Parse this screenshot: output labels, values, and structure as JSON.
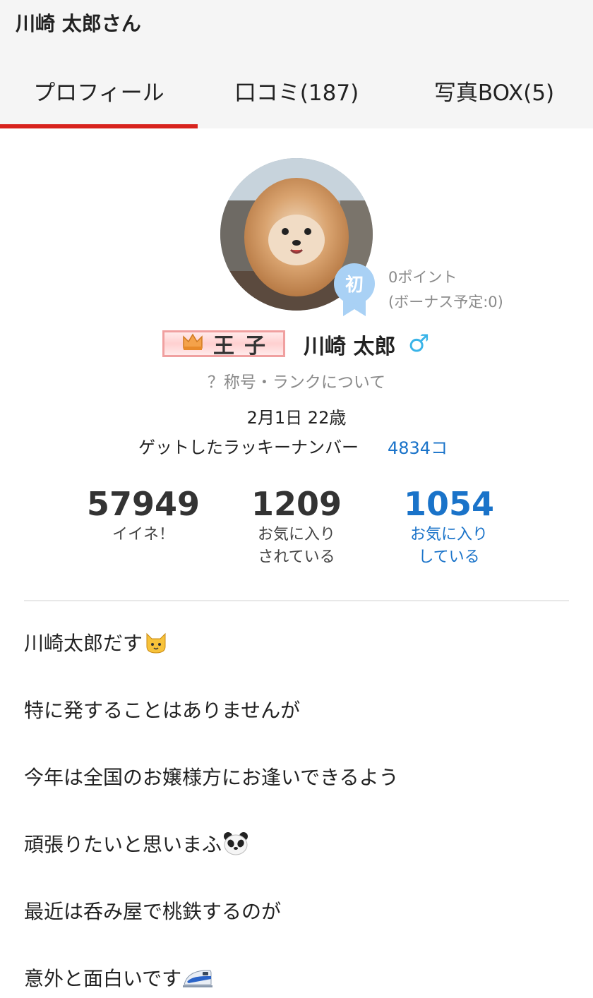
{
  "header": {
    "title": "川崎 太郎さん",
    "tabs": [
      {
        "label": "プロフィール",
        "active": true
      },
      {
        "label": "口コミ(187)",
        "active": false
      },
      {
        "label": "写真BOX(5)",
        "active": false
      }
    ],
    "accent_color": "#d8231d"
  },
  "profile": {
    "badge_char": "初",
    "points": "0ポイント",
    "bonus": "(ボーナス予定:0)",
    "rank_title_char1": "王",
    "rank_title_char2": "子",
    "name": "川崎 太郎",
    "gender_symbol": "♂",
    "rank_help": "？称号・ランクについて",
    "birthday_age": "2月1日 22歳",
    "lucky_label": "ゲットしたラッキーナンバー",
    "lucky_value": "4834コ",
    "link_color": "#1a73c9"
  },
  "stats": [
    {
      "value": "57949",
      "label_line1": "イイネ！",
      "label_line2": ""
    },
    {
      "value": "1209",
      "label_line1": "お気に入り",
      "label_line2": "されている"
    },
    {
      "value": "1054",
      "label_line1": "お気に入り",
      "label_line2": "している"
    }
  ],
  "bio": [
    {
      "text": "川崎太郎だす",
      "icon": "cat-face-icon"
    },
    {
      "text": "特に発することはありませんが",
      "icon": ""
    },
    {
      "text": "今年は全国のお嬢様方にお逢いできるよう",
      "icon": ""
    },
    {
      "text": "頑張りたいと思いまふ",
      "icon": "panda-face-icon"
    },
    {
      "text": "最近は呑み屋で桃鉄するのが",
      "icon": ""
    },
    {
      "text": "意外と面白いです",
      "icon": "bullet-train-icon"
    }
  ]
}
